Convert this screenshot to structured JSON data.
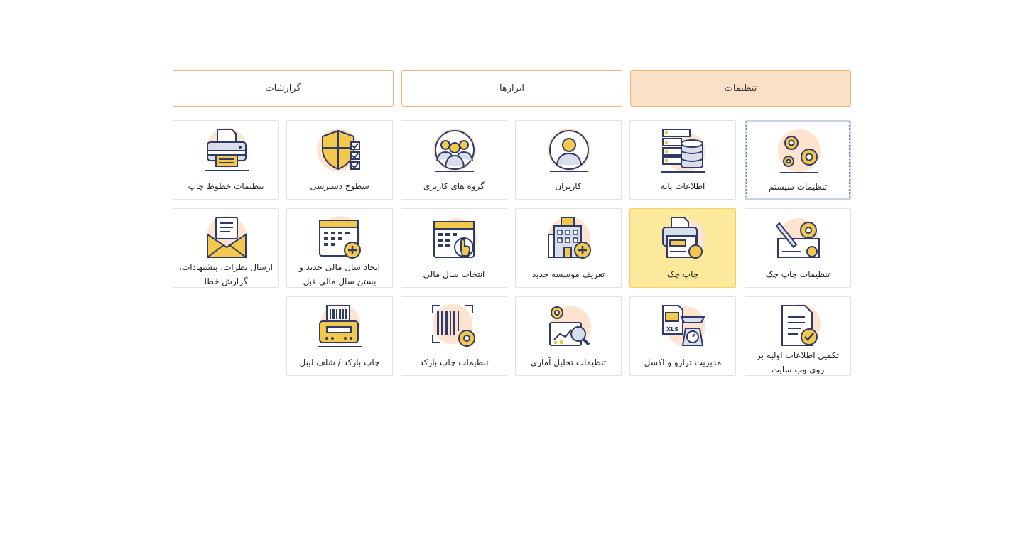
{
  "tabs": [
    {
      "label": "تنظیمات",
      "active": true
    },
    {
      "label": "ابزارها",
      "active": false
    },
    {
      "label": "گزارشات",
      "active": false
    }
  ],
  "items": [
    {
      "label": "تنظیمات سیستم",
      "icon": "gears-icon"
    },
    {
      "label": "اطلاعات پایه",
      "icon": "database-server-icon"
    },
    {
      "label": "کاربران",
      "icon": "user-icon"
    },
    {
      "label": "گروه های کاربری",
      "icon": "user-group-icon"
    },
    {
      "label": "سطوح دسترسی",
      "icon": "shield-checklist-icon"
    },
    {
      "label": "تنظیمات خطوط چاپ",
      "icon": "printer-icon"
    },
    {
      "label": "تنظیمات چاپ چک",
      "icon": "check-settings-icon"
    },
    {
      "label": "چاپ چک",
      "icon": "print-check-icon"
    },
    {
      "label": "تعریف موسسه جدید",
      "icon": "building-add-icon"
    },
    {
      "label": "انتخاب سال مالی",
      "icon": "calendar-hand-icon"
    },
    {
      "label": "ایجاد سال مالی جدید و بستن سال مالی قبل",
      "icon": "calendar-add-icon"
    },
    {
      "label": "ارسال نظرات، پیشنهادات، گزارش خطا",
      "icon": "mail-icon"
    },
    {
      "label": "تکمیل اطلاعات اولیه بر روی وب سایت",
      "icon": "document-check-icon"
    },
    {
      "label": "مدیریت ترازو و اکسل",
      "icon": "scale-excel-icon"
    },
    {
      "label": "تنظیمات تحلیل آماری",
      "icon": "analytics-icon"
    },
    {
      "label": "تنظیمات چاپ بارکد",
      "icon": "barcode-settings-icon"
    },
    {
      "label": "چاپ بارکد / شلف لیبل",
      "icon": "barcode-printer-icon"
    }
  ],
  "colors": {
    "tab_border": "#f0b07e",
    "tab_active_bg": "#fbe0c8",
    "highlight_bg": "#fde99c",
    "icon_outline": "#2f3a66",
    "icon_yellow": "#f2c94c",
    "icon_blob": "#fde3d0"
  }
}
